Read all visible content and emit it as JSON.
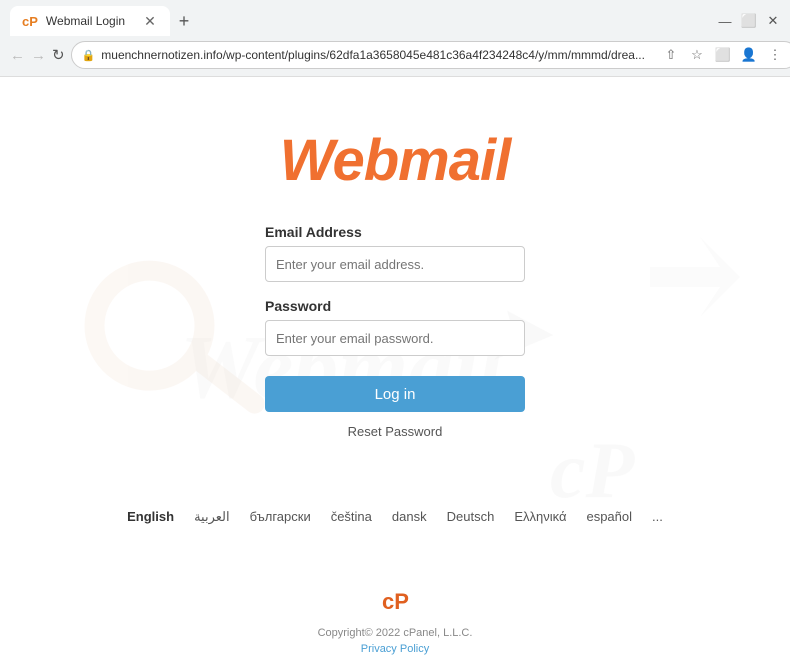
{
  "browser": {
    "tab_title": "Webmail Login",
    "favicon": "cP",
    "url": "muenchnernotizen.info/wp-content/plugins/62dfa1a3658045e481c36a4f234248c4/y/mm/mmmd/drea...",
    "new_tab_label": "+",
    "minimize": "—",
    "restore": "⬜",
    "close": "✕"
  },
  "page": {
    "logo_text": "Webmail",
    "email_label": "Email Address",
    "email_placeholder": "Enter your email address.",
    "password_label": "Password",
    "password_placeholder": "Enter your email password.",
    "login_button": "Log in",
    "reset_password_link": "Reset Password",
    "footer_copyright": "Copyright© 2022 cPanel, L.L.C.",
    "footer_privacy": "Privacy Policy",
    "cpanel_icon": "cP"
  },
  "languages": [
    {
      "code": "en",
      "label": "English",
      "active": true
    },
    {
      "code": "ar",
      "label": "العربية",
      "active": false
    },
    {
      "code": "bg",
      "label": "български",
      "active": false
    },
    {
      "code": "cs",
      "label": "čeština",
      "active": false
    },
    {
      "code": "da",
      "label": "dansk",
      "active": false
    },
    {
      "code": "de",
      "label": "Deutsch",
      "active": false
    },
    {
      "code": "el",
      "label": "Ελληνικά",
      "active": false
    },
    {
      "code": "es",
      "label": "español",
      "active": false
    },
    {
      "code": "more",
      "label": "...",
      "active": false
    }
  ]
}
